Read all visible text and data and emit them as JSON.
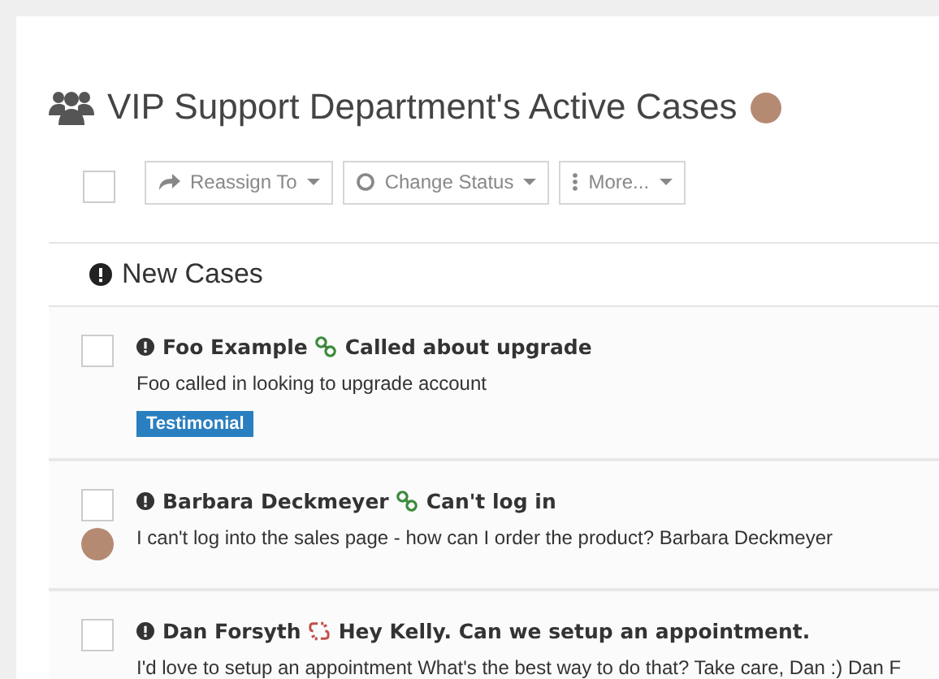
{
  "title": "VIP Support Department's Active Cases",
  "toolbar": {
    "select_all": {
      "checked": false
    },
    "buttons": [
      {
        "kind": "reassign",
        "label": "Reassign To"
      },
      {
        "kind": "status",
        "label": "Change Status"
      },
      {
        "kind": "more",
        "label": "More..."
      }
    ]
  },
  "section": {
    "title": "New Cases"
  },
  "cases": [
    {
      "checked": false,
      "contact": "Foo Example",
      "linked": true,
      "subject": "Called about upgrade",
      "body": "Foo called in looking to upgrade account",
      "tags": [
        "Testimonial"
      ],
      "has_avatar": false
    },
    {
      "checked": false,
      "contact": "Barbara Deckmeyer",
      "linked": true,
      "subject": "Can't log in",
      "body": "I can't log into the sales page - how can I order the product? Barbara Deckmeyer",
      "has_avatar": true
    },
    {
      "checked": false,
      "contact": "Dan Forsyth",
      "linked": false,
      "subject": "Hey Kelly. Can we setup an appointment.",
      "body": "I'd love to setup an appointment What's the best way to do that? Take care, Dan :) Dan F",
      "has_avatar": false
    }
  ]
}
